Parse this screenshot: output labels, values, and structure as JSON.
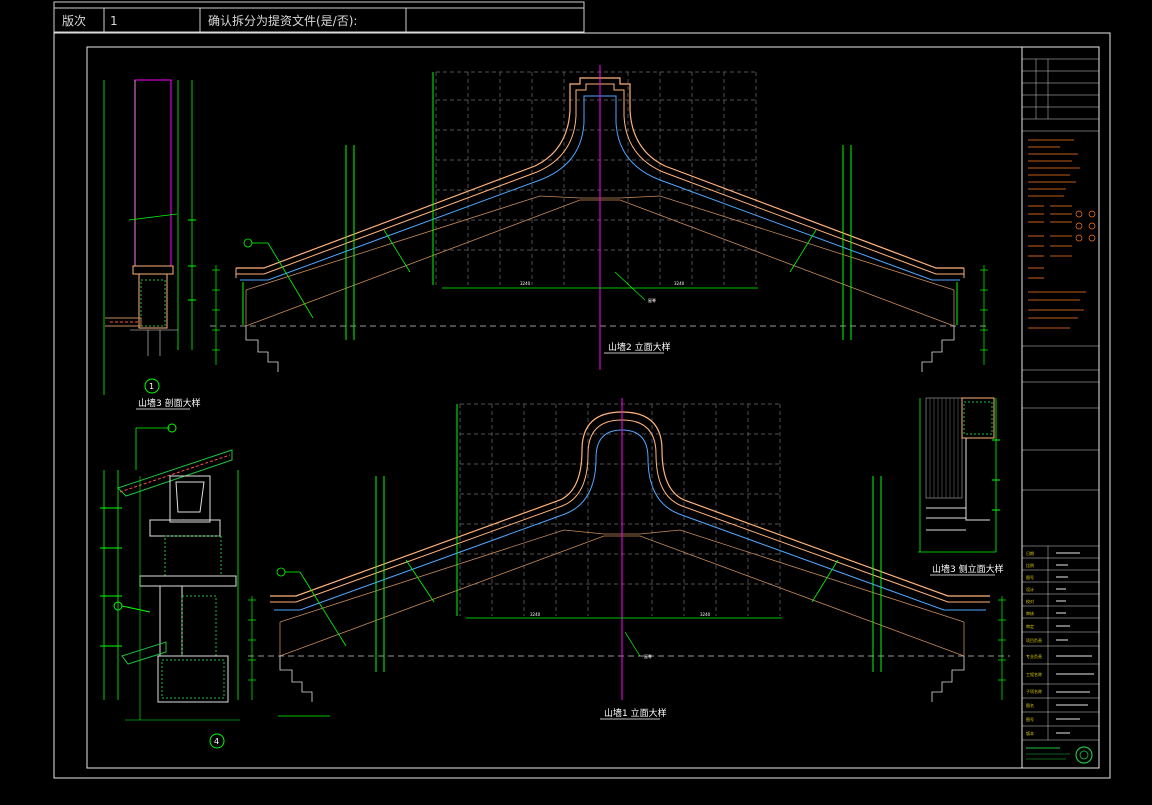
{
  "header": {
    "version_label": "版次",
    "version_value": "1",
    "confirm_text": "确认拆分为提资文件(是/否):"
  },
  "drawings": {
    "section_1_caption": "山墙3 剖面大样",
    "section_1_number": "1",
    "elevation_2_caption": "山墙2 立面大样",
    "elevation_1_caption": "山墙1 立面大样",
    "side_elevation_caption": "山墙3 侧立面大样",
    "section_4_number": "4"
  },
  "title_block": {
    "row_labels": [
      "日期",
      "比例",
      "图号",
      "设计",
      "校对",
      "审核",
      "审定",
      "项目负责",
      "专业负责",
      "工程名称",
      "子项名称",
      "图名",
      "图号",
      "版本"
    ]
  },
  "colors": {
    "background": "#000000",
    "frame": "#ffffff",
    "grid": "#8a8a8a",
    "roof_outer": "#ffb27a",
    "roof_inner": "#4da6ff",
    "guide": "#00ff00",
    "center": "#ff00ff",
    "notes": "#ff7a1a",
    "hatch": "#1fbf3f"
  }
}
